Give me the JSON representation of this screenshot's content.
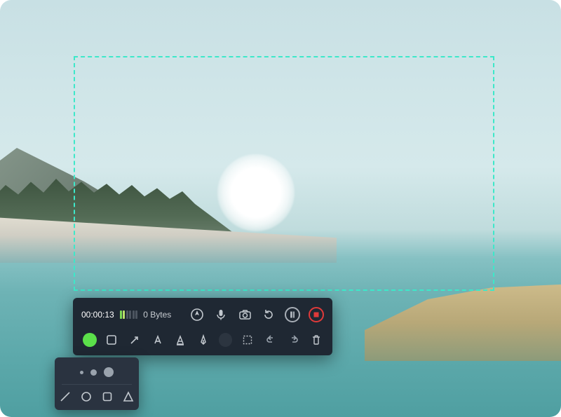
{
  "recorder": {
    "timer": "00:00:13",
    "filesize": "0 Bytes",
    "audio_levels": [
      "#7ed957",
      "#b9e06a",
      "#4c5560",
      "#4c5560",
      "#4c5560",
      "#4c5560"
    ],
    "controls": {
      "cursor": "cursor-highlight",
      "mic": "microphone",
      "camera": "camera",
      "restart": "restart",
      "pause": "pause",
      "stop": "stop"
    },
    "annotation": {
      "color": "#5be04a",
      "tools": {
        "rect": "rectangle",
        "arrow": "arrow",
        "text": "text",
        "highlighter": "highlighter",
        "pen": "pen",
        "fill": "fill",
        "marquee": "marquee",
        "undo": "undo",
        "redo": "redo",
        "trash": "trash"
      }
    }
  },
  "popup": {
    "sizes": [
      "small",
      "medium",
      "large"
    ],
    "shapes": {
      "line": "line",
      "circle": "circle",
      "square": "square",
      "triangle": "triangle"
    }
  }
}
